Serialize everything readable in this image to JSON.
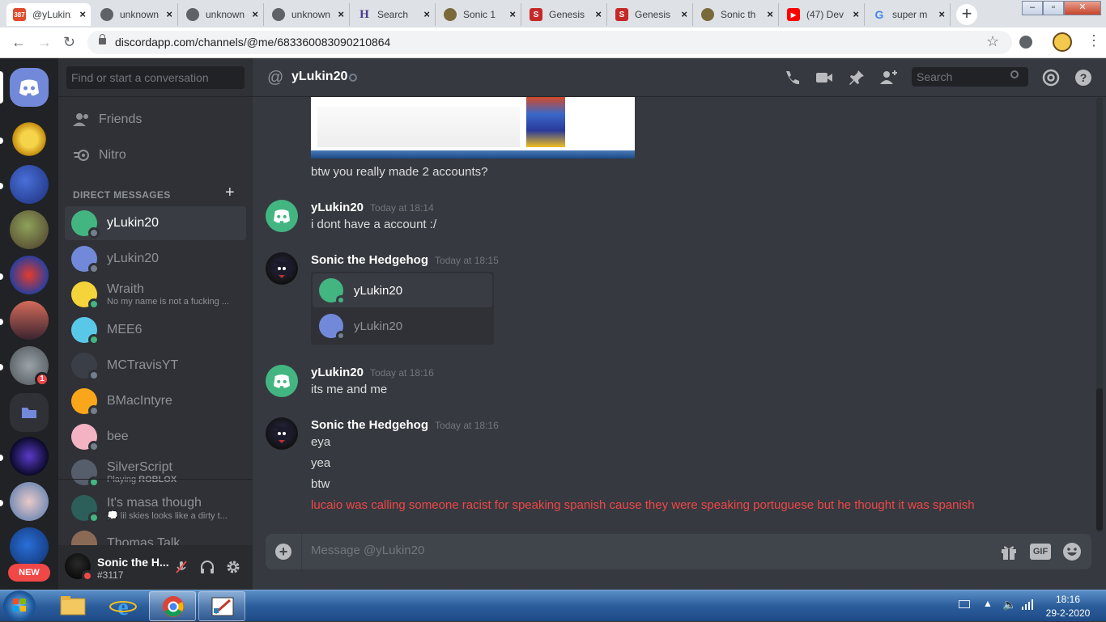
{
  "browser": {
    "tabs": [
      {
        "label": "@yLukin20",
        "badge": "387",
        "active": true
      },
      {
        "label": "unknown"
      },
      {
        "label": "unknown"
      },
      {
        "label": "unknown"
      },
      {
        "label": "Search"
      },
      {
        "label": "Sonic 1"
      },
      {
        "label": "Genesis"
      },
      {
        "label": "Genesis"
      },
      {
        "label": "Sonic th"
      },
      {
        "label": "(47) Dev"
      },
      {
        "label": "super m"
      }
    ],
    "new_tab_label": "+",
    "url": "discordapp.com/channels/@me/683360083090210864"
  },
  "sidebar": {
    "search_placeholder": "Find or start a conversation",
    "friends_label": "Friends",
    "nitro_label": "Nitro",
    "dm_header": "DIRECT MESSAGES",
    "dm_add": "+",
    "dms": [
      {
        "name": "yLukin20",
        "status": "offline",
        "selected": true,
        "avatar_color": "#43b581"
      },
      {
        "name": "yLukin20",
        "status": "offline",
        "avatar_color": "#7289da"
      },
      {
        "name": "Wraith",
        "sub": "No my name is not a fucking ...",
        "status": "online",
        "avatar_color": "#f5d33b"
      },
      {
        "name": "MEE6",
        "status": "online",
        "avatar_color": "#59c8e8"
      },
      {
        "name": "MCTravisYT",
        "status": "offline",
        "avatar_color": "#3a3f47"
      },
      {
        "name": "BMacIntyre",
        "status": "offline",
        "avatar_color": "#faa61a"
      },
      {
        "name": "bee",
        "status": "offline",
        "avatar_color": "#f4b3c2"
      },
      {
        "name": "SilverScript",
        "sub_prefix": "Playing ",
        "sub_bold": "ROBLOX",
        "status": "online",
        "avatar_color": "#565d6b"
      },
      {
        "name": "It's masa though",
        "sub": "💭 lil skies looks like a dirty t...",
        "status": "online",
        "avatar_color": "#2c5f5a"
      },
      {
        "name": "Thomas Talk",
        "status": "offline",
        "avatar_color": "#8a6a55"
      }
    ],
    "guild_badge": "1",
    "new_label": "NEW",
    "user": {
      "name": "Sonic the H...",
      "tag": "#3117"
    }
  },
  "chat": {
    "channel_name": "yLukin20",
    "search_placeholder": "Search",
    "messages": [
      {
        "continuation": true,
        "lines": [
          "btw you really made 2 accounts?"
        ]
      },
      {
        "author": "yLukin20",
        "timestamp": "Today at 18:14",
        "lines": [
          "i dont have a account :/"
        ]
      },
      {
        "author": "Sonic the Hedgehog",
        "timestamp": "Today at 18:15",
        "embed": [
          "yLukin20",
          "yLukin20"
        ]
      },
      {
        "author": "yLukin20",
        "timestamp": "Today at 18:16",
        "lines": [
          "its me and me"
        ]
      },
      {
        "author": "Sonic the Hedgehog",
        "timestamp": "Today at 18:16",
        "lines": [
          "eya",
          "yea",
          "btw"
        ],
        "highlight_line": "lucaio was calling someone racist for speaking spanish cause they were speaking portuguese but he thought it was spanish"
      }
    ],
    "composer_placeholder": "Message @yLukin20",
    "gif_label": "GIF"
  },
  "taskbar": {
    "time": "18:16",
    "date": "29-2-2020"
  },
  "colors": {
    "discord_bg": "#36393f",
    "sidebar_bg": "#2f3136",
    "guild_bg": "#202225",
    "highlight_red": "#f04747",
    "online": "#43b581",
    "blurple": "#7289da"
  }
}
